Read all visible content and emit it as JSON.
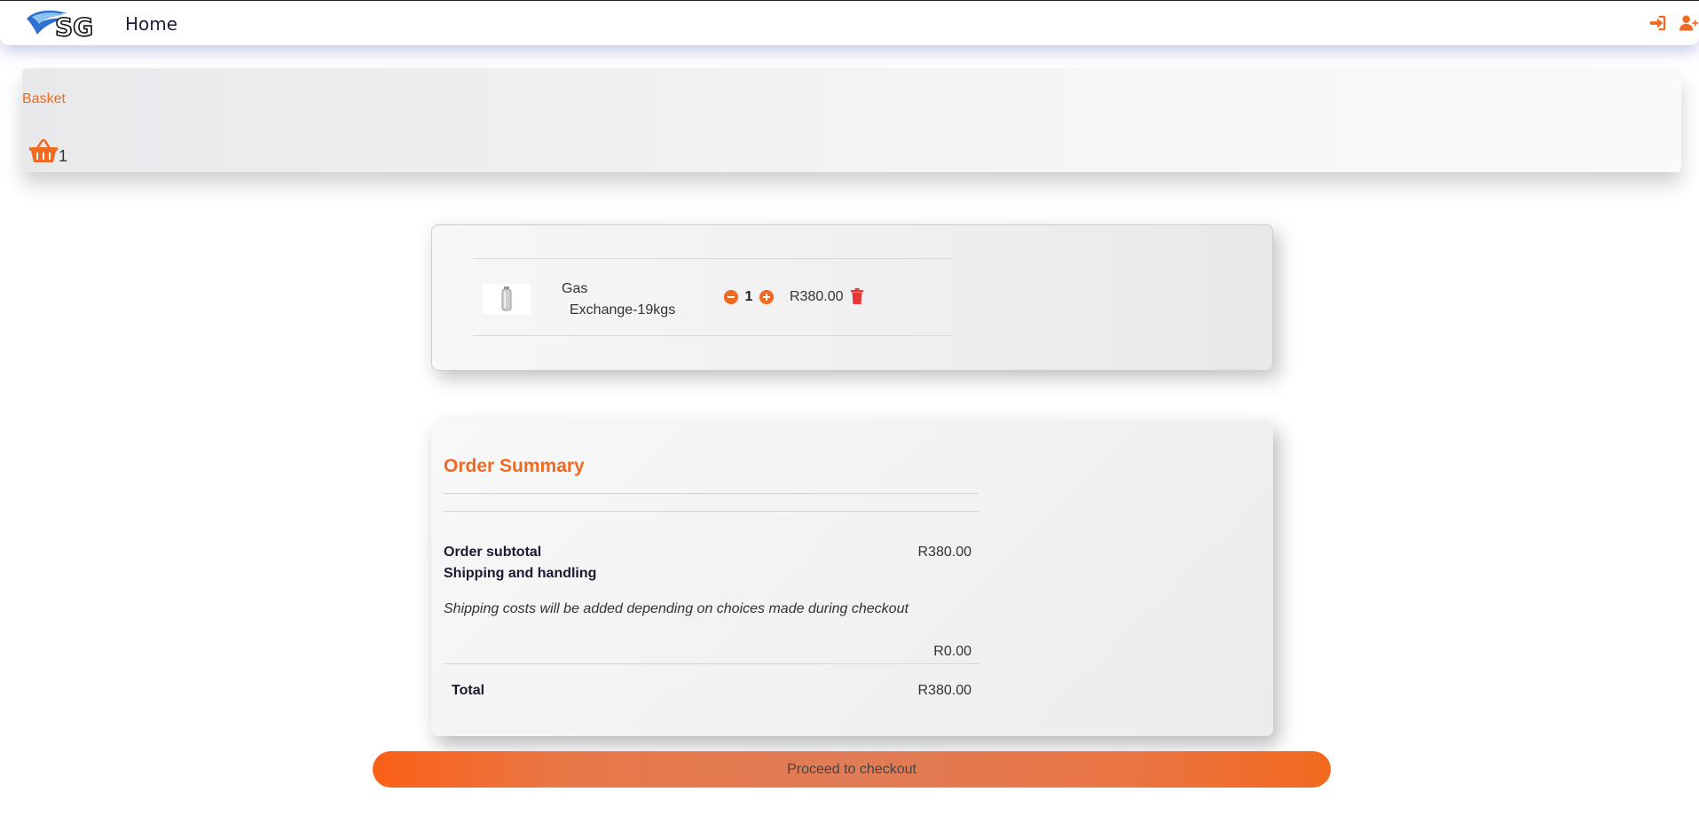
{
  "navbar": {
    "home_label": "Home",
    "login_icon": "sign-in-icon",
    "register_icon": "user-plus-icon"
  },
  "basket": {
    "link_label": "Basket",
    "count": "1"
  },
  "cart": {
    "items": [
      {
        "name_line1": "Gas",
        "name_line2": "Exchange-19kgs",
        "quantity": "1",
        "price": "R380.00"
      }
    ]
  },
  "summary": {
    "title": "Order Summary",
    "subtotal_label": "Order subtotal",
    "subtotal_value": "R380.00",
    "shipping_label": "Shipping and handling",
    "shipping_note": "Shipping costs will be added depending on choices made during checkout",
    "shipping_value": "R0.00",
    "total_label": "Total",
    "total_value": "R380.00"
  },
  "checkout": {
    "button_label": "Proceed to checkout"
  },
  "colors": {
    "accent": "#f06a22",
    "danger": "#e53935",
    "text": "#1b1b2f"
  }
}
